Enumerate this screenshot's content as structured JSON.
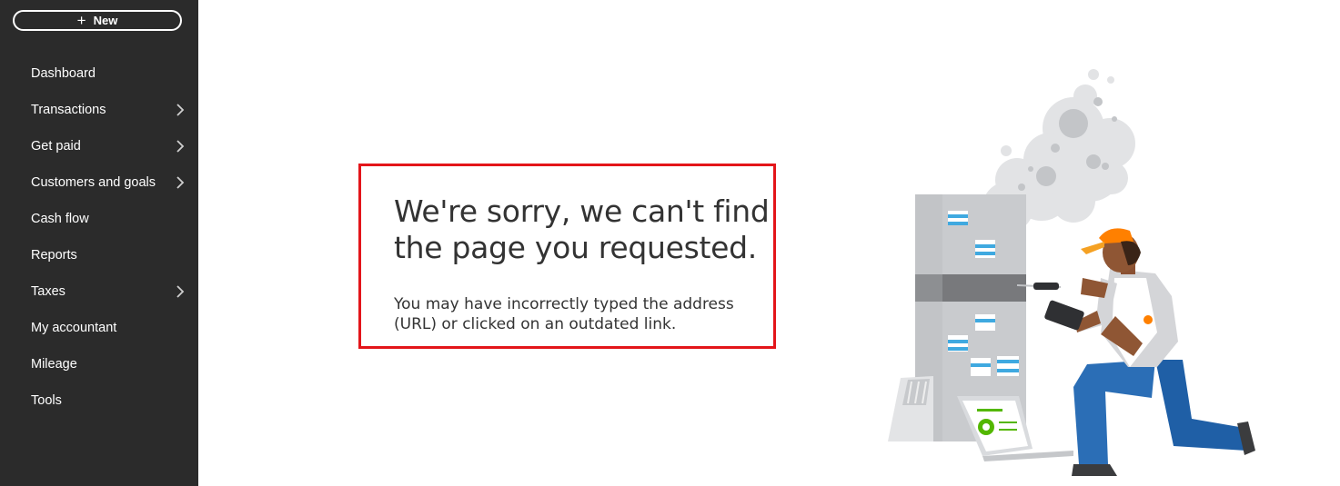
{
  "sidebar": {
    "new_button": {
      "label": "New",
      "icon": "plus-icon"
    },
    "items": [
      {
        "label": "Dashboard",
        "has_submenu": false
      },
      {
        "label": "Transactions",
        "has_submenu": true
      },
      {
        "label": "Get paid",
        "has_submenu": true
      },
      {
        "label": "Customers and goals",
        "has_submenu": true
      },
      {
        "label": "Cash flow",
        "has_submenu": false
      },
      {
        "label": "Reports",
        "has_submenu": false
      },
      {
        "label": "Taxes",
        "has_submenu": true
      },
      {
        "label": "My accountant",
        "has_submenu": false
      },
      {
        "label": "Mileage",
        "has_submenu": false
      },
      {
        "label": "Tools",
        "has_submenu": false
      }
    ]
  },
  "error": {
    "title": "We're sorry, we can't find the page you requested.",
    "message": "You may have incorrectly typed the address (URL) or clicked on an outdated link."
  },
  "colors": {
    "sidebar_bg": "#2b2b2b",
    "highlight_border": "#e3151a",
    "text": "#333333",
    "accent_green": "#53b700",
    "server_blue": "#3fa9e0",
    "worker_orange": "#ff8000",
    "worker_pants": "#1f5fa6"
  }
}
